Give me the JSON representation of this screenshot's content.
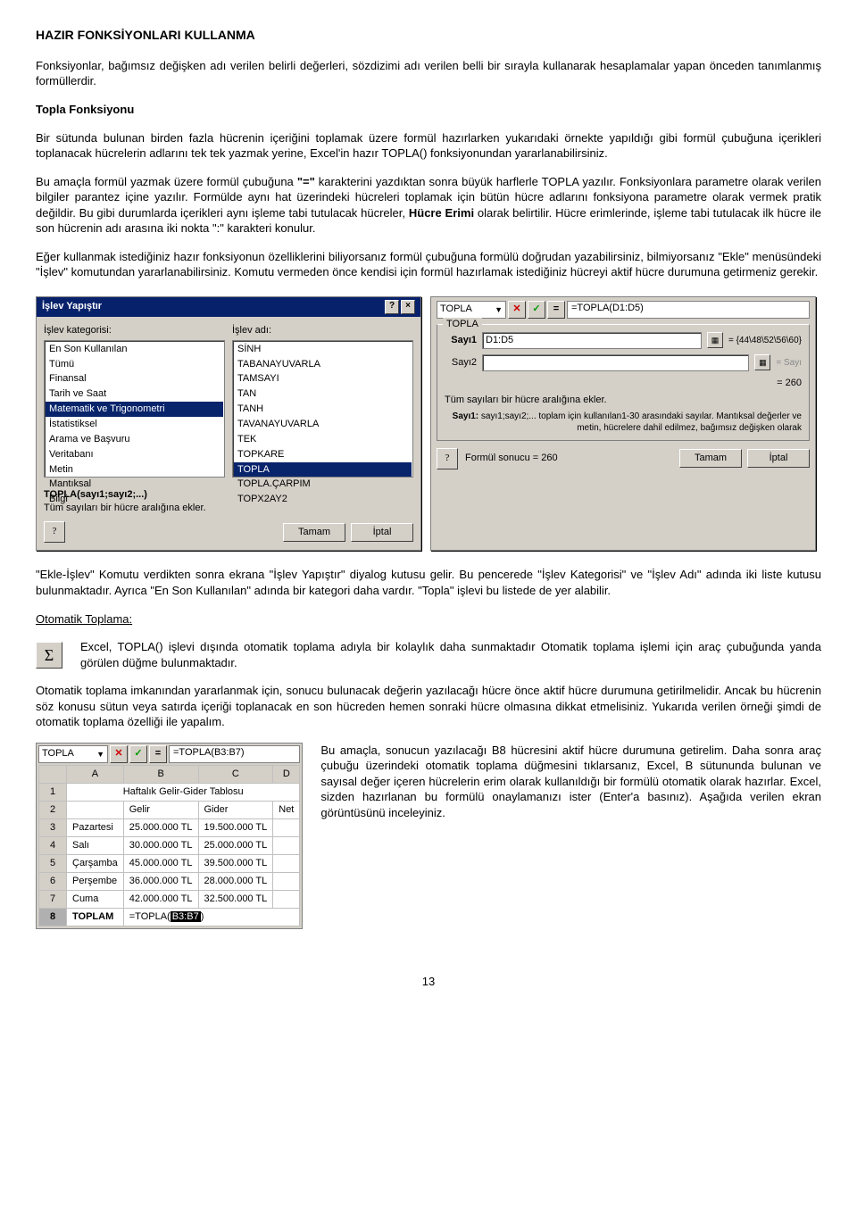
{
  "title": "HAZIR FONKSİYONLARI KULLANMA",
  "intro": "Fonksiyonlar, bağımsız değişken adı verilen belirli değerleri, sözdizimi adı verilen belli bir sırayla kullanarak hesaplamalar yapan önceden tanımlanmış formüllerdir.",
  "topla_heading": "Topla Fonksiyonu",
  "topla_p1": "Bir sütunda bulunan birden fazla hücrenin içeriğini toplamak üzere formül hazırlarken yukarıdaki örnekte yapıldığı gibi formül çubuğuna içerikleri toplanacak hücrelerin adlarını tek tek yazmak yerine, Excel'in hazır TOPLA() fonksiyonundan yararlanabilirsiniz.",
  "topla_p2a": "Bu amaçla formül yazmak üzere formül çubuğuna ",
  "topla_p2b": "\"=\"",
  "topla_p2c": " karakterini yazdıktan sonra büyük harflerle TOPLA yazılır. Fonksiyonlara parametre olarak verilen bilgiler parantez içine yazılır. Formülde aynı hat üzerindeki hücreleri toplamak için bütün hücre adlarını fonksiyona parametre olarak vermek pratik değildir. Bu gibi durumlarda içerikleri aynı işleme tabi tutulacak hücreler, ",
  "topla_p2d": "Hücre Erimi",
  "topla_p2e": " olarak belirtilir. Hücre erimlerinde, işleme tabi tutulacak ilk hücre ile son hücrenin adı arasına iki nokta \":\" karakteri konulur.",
  "topla_p3": "Eğer kullanmak istediğiniz hazır fonksiyonun özelliklerini biliyorsanız formül çubuğuna formülü doğrudan yazabilirsiniz, bilmiyorsanız \"Ekle\" menüsündeki \"İşlev\" komutundan yararlanabilirsiniz. Komutu vermeden önce kendisi için formül hazırlamak istediğiniz hücreyi aktif hücre durumuna getirmeniz gerekir.",
  "dialog1": {
    "title": "İşlev Yapıştır",
    "cat_label": "İşlev kategorisi:",
    "name_label": "İşlev adı:",
    "categories": [
      "En Son Kullanılan",
      "Tümü",
      "Finansal",
      "Tarih ve Saat",
      "Matematik ve Trigonometri",
      "İstatistiksel",
      "Arama ve Başvuru",
      "Veritabanı",
      "Metin",
      "Mantıksal",
      "Bilgi"
    ],
    "cat_selected": "Matematik ve Trigonometri",
    "names": [
      "SİNH",
      "TABANAYUVARLA",
      "TAMSAYI",
      "TAN",
      "TANH",
      "TAVANAYUVARLA",
      "TEK",
      "TOPKARE",
      "TOPLA",
      "TOPLA.ÇARPIM",
      "TOPX2AY2"
    ],
    "name_selected": "TOPLA",
    "syntax": "TOPLA(sayı1;sayı2;...)",
    "desc": "Tüm sayıları bir hücre aralığına ekler.",
    "ok": "Tamam",
    "cancel": "İptal"
  },
  "dialog2": {
    "combo": "TOPLA",
    "formula": "=TOPLA(D1:D5)",
    "group": "TOPLA",
    "s1": "Sayı1",
    "s1v": "D1:D5",
    "s1r": "= {44\\48\\52\\56\\60}",
    "s2": "Sayı2",
    "s2ph": "= Sayı",
    "result_num": "= 260",
    "desc": "Tüm sayıları bir hücre aralığına ekler.",
    "hint_b": "Sayı1:",
    "hint": " sayı1;sayı2;... toplam için kullanılan1-30 arasındaki sayılar. Mantıksal değerler ve metin, hücrelere dahil edilmez, bağımsız değişken olarak",
    "result": "Formül sonucu = 260",
    "ok": "Tamam",
    "cancel": "İptal"
  },
  "after_dialogs": "\"Ekle-İşlev\" Komutu verdikten sonra ekrana \"İşlev Yapıştır\" diyalog kutusu gelir. Bu pencerede \"İşlev Kategorisi\" ve \"İşlev Adı\" adında iki liste kutusu bulunmaktadır. Ayrıca \"En Son Kullanılan\" adında bir kategori daha vardır. \"Topla\" işlevi bu listede de yer alabilir.",
  "oto_heading": "Otomatik Toplama:",
  "oto_p1": "Excel, TOPLA() işlevi dışında otomatik toplama adıyla bir kolaylık daha sunmaktadır Otomatik toplama işlemi için araç çubuğunda yanda görülen düğme bulunmaktadır.",
  "oto_p2": "Otomatik toplama imkanından yararlanmak için, sonucu bulunacak değerin yazılacağı hücre önce aktif hücre durumuna getirilmelidir. Ancak bu hücrenin söz konusu sütun veya satırda içeriği toplanacak en son hücreden hemen sonraki hücre olmasına dikkat etmelisiniz. Yukarıda verilen örneği şimdi de otomatik toplama özelliği ile yapalım.",
  "sheet": {
    "combo": "TOPLA",
    "formula": "=TOPLA(B3:B7)",
    "cols": [
      "A",
      "B",
      "C",
      "D"
    ],
    "merge_title": "Haftalık Gelir-Gider Tablosu",
    "headers": [
      "",
      "Gelir",
      "Gider",
      "Net"
    ],
    "rows": [
      [
        "Pazartesi",
        "25.000.000 TL",
        "19.500.000 TL",
        ""
      ],
      [
        "Salı",
        "30.000.000 TL",
        "25.000.000 TL",
        ""
      ],
      [
        "Çarşamba",
        "45.000.000 TL",
        "39.500.000 TL",
        ""
      ],
      [
        "Perşembe",
        "36.000.000 TL",
        "28.000.000 TL",
        ""
      ],
      [
        "Cuma",
        "42.000.000 TL",
        "32.500.000 TL",
        ""
      ]
    ],
    "toplam_label": "TOPLAM",
    "toplam_formula_pre": "=TOPLA(",
    "toplam_formula_range": "B3:B7",
    "toplam_formula_post": ")"
  },
  "right_p": "Bu amaçla, sonucun yazılacağı B8 hücresini aktif hücre durumuna getirelim. Daha sonra araç çubuğu üzerindeki otomatik toplama düğmesini tıklarsanız, Excel, B sütununda bulunan ve sayısal değer içeren hücrelerin erim olarak kullanıldığı bir formülü otomatik olarak hazırlar. Excel, sizden hazırlanan bu formülü onaylamanızı ister (Enter'a basınız). Aşağıda verilen ekran görüntüsünü inceleyiniz.",
  "pagenum": "13",
  "sigma": "Σ"
}
